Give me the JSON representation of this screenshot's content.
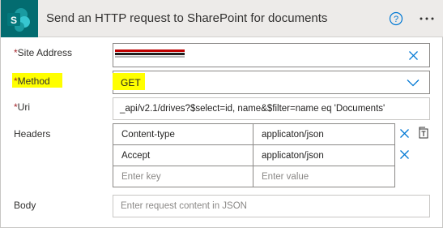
{
  "header": {
    "title": "Send an HTTP request to SharePoint for documents",
    "app_logo_letter": "S",
    "accent_color": "#036c70",
    "help_icon": "help-circle-icon",
    "more_icon": "more-ellipsis-icon"
  },
  "fields": {
    "site_address": {
      "required_mark": "*",
      "label": "Site Address",
      "value": ""
    },
    "method": {
      "required_mark": "*",
      "label": "Method",
      "value": "GET"
    },
    "uri": {
      "required_mark": "*",
      "label": "Uri",
      "value": "_api/v2.1/drives?$select=id, name&$filter=name eq 'Documents'"
    },
    "headers": {
      "label": "Headers",
      "rows": [
        {
          "key": "Content-type",
          "value": "applicaton/json"
        },
        {
          "key": "Accept",
          "value": "applicaton/json"
        }
      ],
      "key_placeholder": "Enter key",
      "value_placeholder": "Enter value"
    },
    "body": {
      "label": "Body",
      "placeholder": "Enter request content in JSON"
    }
  },
  "highlight_color": "#ffff00"
}
